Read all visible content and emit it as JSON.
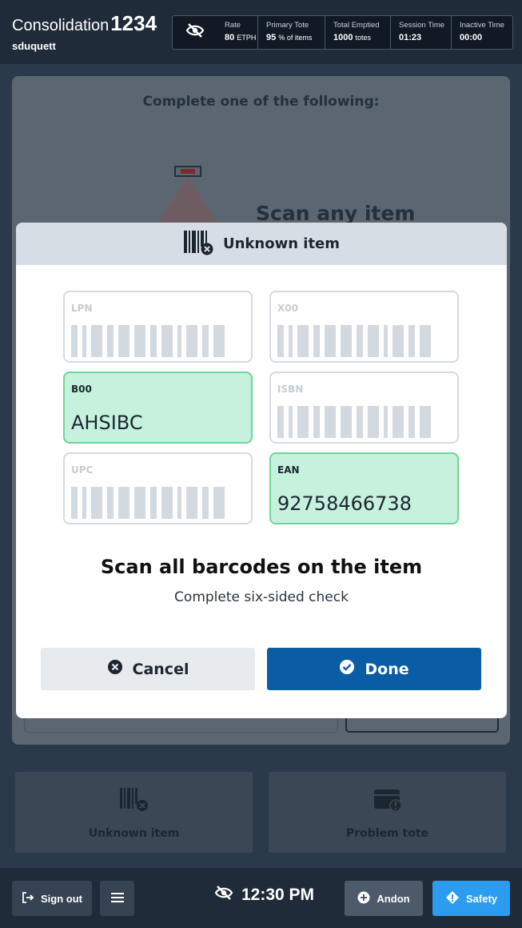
{
  "header": {
    "app_name": "Consolidation",
    "station_number": "1234",
    "username": "sduquett",
    "stats": [
      {
        "label": "Rate",
        "value": "80",
        "unit": "ETPH"
      },
      {
        "label": "Primary Tote",
        "value": "95",
        "unit": "% of items"
      },
      {
        "label": "Total Emptied",
        "value": "1000",
        "unit": "totes"
      },
      {
        "label": "Session Time",
        "value": "01:23",
        "unit": ""
      },
      {
        "label": "Inactive Time",
        "value": "00:00",
        "unit": ""
      }
    ]
  },
  "workspace": {
    "title": "Complete one of the following:",
    "scan_any": "Scan any item"
  },
  "modal": {
    "title": "Unknown item",
    "barcodes": [
      {
        "name": "LPN",
        "value": "",
        "scanned": false
      },
      {
        "name": "X00",
        "value": "",
        "scanned": false
      },
      {
        "name": "B00",
        "value": "AHSIBC",
        "scanned": true
      },
      {
        "name": "ISBN",
        "value": "",
        "scanned": false
      },
      {
        "name": "UPC",
        "value": "",
        "scanned": false
      },
      {
        "name": "EAN",
        "value": "92758466738",
        "scanned": true
      }
    ],
    "message": "Scan all barcodes on the item",
    "sub_message": "Complete six-sided check",
    "cancel_label": "Cancel",
    "done_label": "Done"
  },
  "actions": {
    "unknown_item": "Unknown item",
    "problem_tote": "Problem tote"
  },
  "footer": {
    "sign_out": "Sign out",
    "time": "12:30 PM",
    "andon": "Andon",
    "safety": "Safety"
  },
  "colors": {
    "header_bg": "#1f2b38",
    "scanned_bg": "#c6f1dc",
    "scanned_border": "#6fd59a",
    "done_button": "#0a5da5",
    "safety_button": "#2b9cf0"
  }
}
